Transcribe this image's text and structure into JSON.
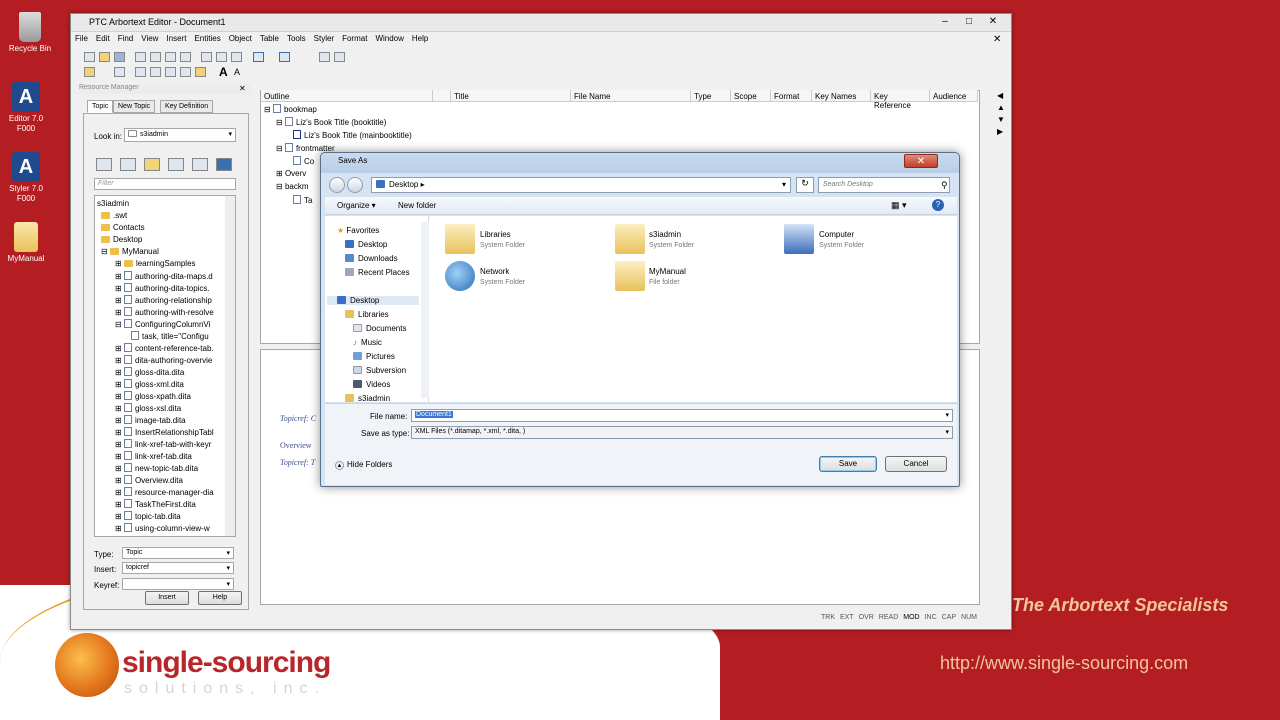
{
  "desktop": {
    "icons": [
      {
        "label": "Recycle Bin",
        "icon": "recycle-bin-icon"
      },
      {
        "label": "Editor 7.0\nF000",
        "icon": "arbortext-editor-icon"
      },
      {
        "label": "Styler 7.0\nF000",
        "icon": "arbortext-styler-icon"
      },
      {
        "label": "MyManual",
        "icon": "folder-icon"
      }
    ],
    "tagline": "The Arbortext Specialists",
    "url": "http://www.single-sourcing.com",
    "logo": {
      "name": "single-sourcing",
      "sub": "solutions, inc."
    }
  },
  "app": {
    "title": "PTC Arbortext Editor - Document1",
    "menu": [
      "File",
      "Edit",
      "Find",
      "View",
      "Insert",
      "Entities",
      "Object",
      "Table",
      "Tools",
      "Styler",
      "Format",
      "Window",
      "Help"
    ],
    "resource_manager": {
      "title": "Resource Manager",
      "tabs": [
        "Topic",
        "New Topic",
        "Key Definition"
      ],
      "look_in_label": "Look in:",
      "look_in_value": "s3iadmin",
      "filter_placeholder": "Filter",
      "tree": [
        "s3iadmin",
        ".swt",
        "Contacts",
        "Desktop",
        "MyManual",
        "learningSamples",
        "authoring-dita-maps.d",
        "authoring-dita-topics.",
        "authoring-relationship",
        "authoring-with-resolve",
        "ConfiguringColumnVi",
        "task, title=\"Configu",
        "content-reference-tab.",
        "dita-authoring-overvie",
        "gloss-dita.dita",
        "gloss-xml.dita",
        "gloss-xpath.dita",
        "gloss-xsl.dita",
        "image-tab.dita",
        "InsertRelationshipTabl",
        "link-xref-tab-with-keyr",
        "link-xref-tab.dita",
        "new-topic-tab.dita",
        "Overview.dita",
        "resource-manager-dia",
        "TaskTheFirst.dita",
        "topic-tab.dita",
        "using-column-view-w"
      ],
      "type_label": "Type:",
      "type_value": "Topic",
      "insert_label": "Insert:",
      "insert_value": "topicref",
      "keyref_label": "Keyref:",
      "insert_button": "Insert",
      "help_button": "Help"
    },
    "outline": {
      "columns": [
        "Outline",
        "Title",
        "File Name",
        "Type",
        "Scope",
        "Format",
        "Key Names",
        "Key Reference",
        "Audience"
      ],
      "rows": [
        "bookmap",
        "Liz's Book Title (booktitle)",
        "Liz's Book Title (mainbooktitle)",
        "frontmatter",
        "Co",
        "Overv",
        "backm",
        "Ta"
      ]
    },
    "editor": {
      "lines": [
        "Topicref: C",
        "Overview",
        "Topicref: T"
      ]
    },
    "status": [
      "TRK",
      "EXT",
      "OVR",
      "READ",
      "MOD",
      "INC",
      "CAP",
      "NUM"
    ]
  },
  "dialog": {
    "title": "Save As",
    "breadcrumb": "Desktop",
    "search_placeholder": "Search Desktop",
    "organize": "Organize ▾",
    "new_folder": "New folder",
    "nav": {
      "favorites": [
        "Favorites",
        "Desktop",
        "Downloads",
        "Recent Places"
      ],
      "tree": [
        "Desktop",
        "Libraries",
        "Documents",
        "Music",
        "Pictures",
        "Subversion",
        "Videos",
        "s3iadmin"
      ]
    },
    "items": [
      {
        "name": "Libraries",
        "sub": "System Folder"
      },
      {
        "name": "s3iadmin",
        "sub": "System Folder"
      },
      {
        "name": "Computer",
        "sub": "System Folder"
      },
      {
        "name": "Network",
        "sub": "System Folder"
      },
      {
        "name": "MyManual",
        "sub": "File folder"
      }
    ],
    "file_name_label": "File name:",
    "file_name_value": "Document1",
    "save_as_type_label": "Save as type:",
    "save_as_type_value": "XML Files (*.ditamap, *.xml, *.dita, )",
    "hide_folders": "Hide Folders",
    "save_button": "Save",
    "cancel_button": "Cancel"
  }
}
